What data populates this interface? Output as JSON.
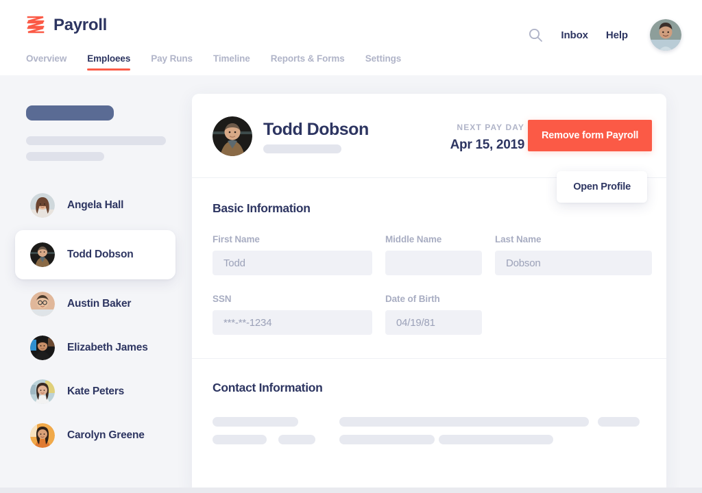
{
  "brand": {
    "name": "Payroll",
    "logo_icon": "payroll-zigzag-logo",
    "accent_color": "#fb5a46"
  },
  "header": {
    "search_icon": "search-icon",
    "links": [
      {
        "label": "Inbox"
      },
      {
        "label": "Help"
      }
    ],
    "avatar": "user-avatar"
  },
  "tabs": [
    {
      "label": "Overview",
      "active": false
    },
    {
      "label": "Emploees",
      "active": true
    },
    {
      "label": "Pay Runs",
      "active": false
    },
    {
      "label": "Timeline",
      "active": false
    },
    {
      "label": "Reports & Forms",
      "active": false
    },
    {
      "label": "Settings",
      "active": false
    }
  ],
  "sidebar": {
    "employees": [
      {
        "name": "Angela Hall",
        "selected": false
      },
      {
        "name": "Todd Dobson",
        "selected": true
      },
      {
        "name": "Austin Baker",
        "selected": false
      },
      {
        "name": "Elizabeth James",
        "selected": false
      },
      {
        "name": "Kate Peters",
        "selected": false
      },
      {
        "name": "Carolyn Greene",
        "selected": false
      }
    ]
  },
  "employee_card": {
    "name": "Todd Dobson",
    "payday_label": "NEXT PAY DAY",
    "payday_value": "Apr 15, 2019",
    "remove_button": "Remove form Payroll",
    "open_profile_button": "Open Profile"
  },
  "basic_information": {
    "title": "Basic Information",
    "fields": [
      {
        "label": "First Name",
        "value": "Todd",
        "placeholder": "First Name"
      },
      {
        "label": "Middle Name",
        "value": "",
        "placeholder": ""
      },
      {
        "label": "Last Name",
        "value": "Dobson",
        "placeholder": "Last Name"
      },
      {
        "label": "SSN",
        "value": "***-**-1234",
        "placeholder": "SSN"
      },
      {
        "label": "Date of Birth",
        "value": "04/19/81",
        "placeholder": "Date of Birth"
      }
    ]
  },
  "contact_information": {
    "title": "Contact Information"
  }
}
